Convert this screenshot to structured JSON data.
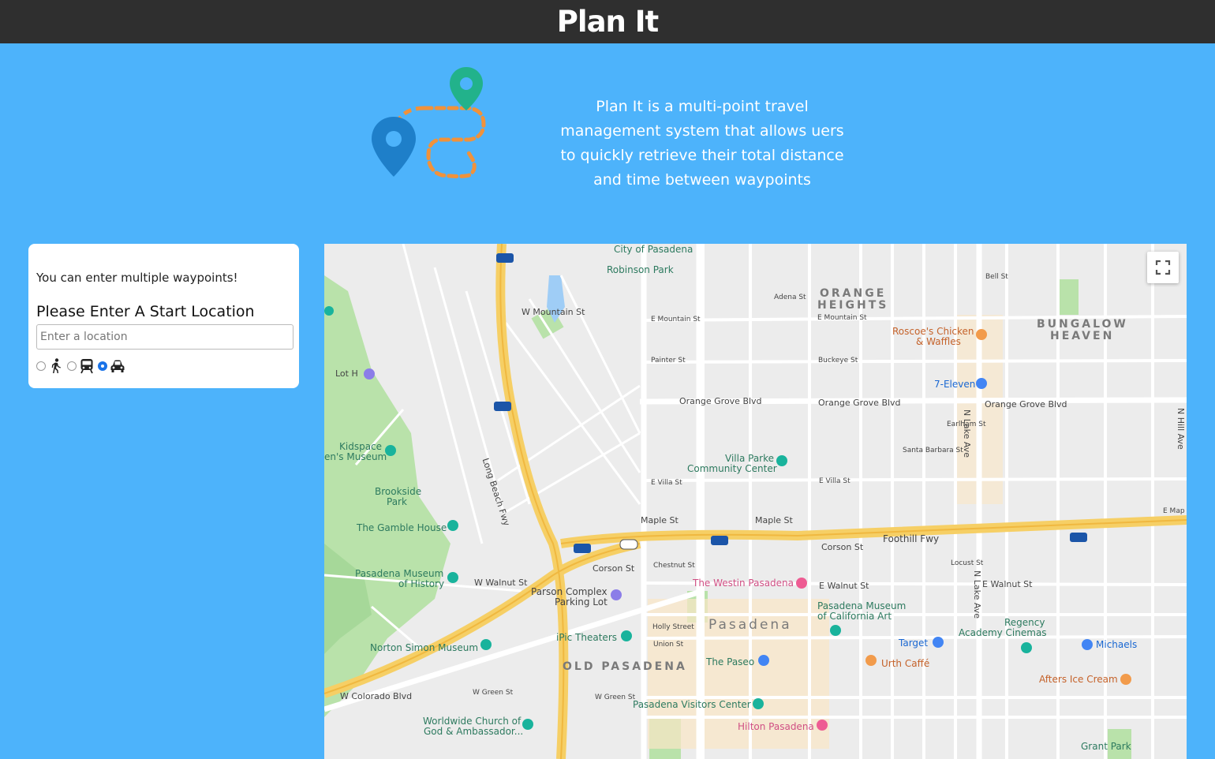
{
  "header": {
    "title": "Plan It"
  },
  "intro": {
    "tagline": "Plan It is a multi-point travel management system that allows uers to quickly retrieve their total distance and time between waypoints"
  },
  "panel": {
    "hint": "You can enter multiple waypoints!",
    "start_label": "Please Enter A Start Location",
    "start_placeholder": "Enter a location",
    "modes": [
      {
        "icon": "walking-icon",
        "selected": false
      },
      {
        "icon": "transit-icon",
        "selected": false
      },
      {
        "icon": "car-icon",
        "selected": true
      }
    ]
  },
  "map": {
    "labels": {
      "city_hall": "City of Pasadena",
      "robinson": "Robinson Park",
      "orange_heights_1": "ORANGE",
      "orange_heights_2": "HEIGHTS",
      "bungalow_1": "BUNGALOW",
      "bungalow_2": "HEAVEN",
      "roscoes_1": "Roscoe's Chicken",
      "roscoes_2": "& Waffles",
      "seven_eleven": "7-Eleven",
      "lot_h": "Lot H",
      "kidspace_1": "Kidspace",
      "kidspace_2": "en's Museum",
      "brookside_1": "Brookside",
      "brookside_2": "Park",
      "gamble": "The Gamble House",
      "villa_parke_1": "Villa Parke",
      "villa_parke_2": "Community Center",
      "museum_history_1": "Pasadena Museum",
      "museum_history_2": "of History",
      "parson_1": "Parson Complex",
      "parson_2": "Parking Lot",
      "westin": "The Westin Pasadena",
      "museum_ca_1": "Pasadena Museum",
      "museum_ca_2": "of California Art",
      "regency_1": "Regency",
      "regency_2": "Academy Cinemas",
      "target": "Target",
      "michaels": "Michaels",
      "ipic": "iPic Theaters",
      "norton": "Norton Simon Museum",
      "pasadena": "Pasadena",
      "old_pasadena": "OLD PASADENA",
      "paseo": "The Paseo",
      "urth": "Urth Caffé",
      "afters": "Afters Ice Cream",
      "visitors": "Pasadena Visitors Center",
      "hilton": "Hilton Pasadena",
      "worldwide_1": "Worldwide Church of",
      "worldwide_2": "God & Ambassador...",
      "grant": "Grant Park",
      "orange_grove_1": "Orange Grove Blvd",
      "orange_grove_2": "Orange Grove Blvd",
      "orange_grove_3": "Orange Grove Blvd",
      "maple_1": "Maple St",
      "maple_2": "Maple St",
      "foothill": "Foothill Fwy",
      "corson_1": "Corson St",
      "corson_2": "Corson St",
      "walnut_1": "W Walnut St",
      "walnut_2": "E Walnut St",
      "walnut_3": "E Walnut St",
      "colorado": "W Colorado Blvd",
      "holly": "Holly Street",
      "mountain_1": "W Mountain St",
      "mountain_2": "E Mountain St",
      "mountain_3": "E Mountain St",
      "villa_1": "E Villa St",
      "villa_2": "E Villa St",
      "long_beach": "Long Beach Fwy",
      "green_1": "W Green St",
      "green_2": "W Green St",
      "adena": "Adena St",
      "bell": "Bell St",
      "buckeye": "Buckeye St",
      "painter": "Painter St",
      "earlham": "Earlham St",
      "santa_barbara": "Santa Barbara St",
      "union": "Union St",
      "chestnut": "Chestnut St",
      "locust": "Locust St",
      "n_lake": "N Lake Ave",
      "s_lake": "N Lake Ave",
      "hill_ave": "N Hill Ave",
      "e_map": "E Map"
    },
    "colors": {
      "freeway": "#f6cf65",
      "arterial": "#ffffff",
      "park": "#b9e2aa",
      "water": "#9fcdf6",
      "highlight": "#fbe7c6"
    }
  }
}
